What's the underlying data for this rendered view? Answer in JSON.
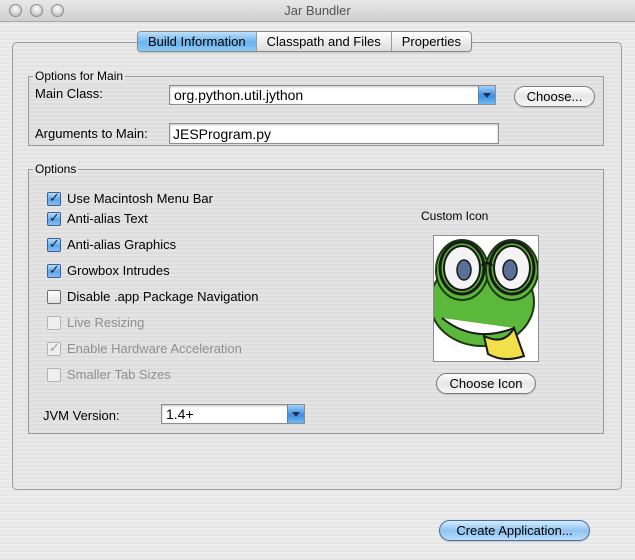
{
  "window": {
    "title": "Jar Bundler"
  },
  "tabs": [
    {
      "label": "Build Information",
      "active": true
    },
    {
      "label": "Classpath and Files",
      "active": false
    },
    {
      "label": "Properties",
      "active": false
    }
  ],
  "main_options": {
    "group_title": "Options for Main",
    "main_class_label": "Main Class:",
    "main_class_value": "org.python.util.jython",
    "choose_button": "Choose...",
    "arguments_label": "Arguments to Main:",
    "arguments_value": "JESProgram.py"
  },
  "options": {
    "group_title": "Options",
    "checkboxes": [
      {
        "label": "Use Macintosh Menu Bar",
        "checked": true,
        "enabled": true
      },
      {
        "label": "Anti-alias Text",
        "checked": true,
        "enabled": true
      },
      {
        "label": "Anti-alias Graphics",
        "checked": true,
        "enabled": true
      },
      {
        "label": "Growbox Intrudes",
        "checked": true,
        "enabled": true
      },
      {
        "label": "Disable .app Package Navigation",
        "checked": false,
        "enabled": true
      },
      {
        "label": "Live Resizing",
        "checked": false,
        "enabled": false
      },
      {
        "label": "Enable Hardware Acceleration",
        "checked": true,
        "enabled": false
      },
      {
        "label": "Smaller Tab Sizes",
        "checked": false,
        "enabled": false
      }
    ],
    "jvm_label": "JVM Version:",
    "jvm_value": "1.4+",
    "custom_icon_label": "Custom Icon",
    "choose_icon_button": "Choose Icon"
  },
  "footer": {
    "create_button": "Create Application..."
  },
  "colors": {
    "accent": "#6ab3ec",
    "frog_green": "#5cb83a",
    "frog_tongue": "#f2e04a"
  },
  "icons": {
    "custom_icon_image": "frog-with-glasses-icon"
  }
}
